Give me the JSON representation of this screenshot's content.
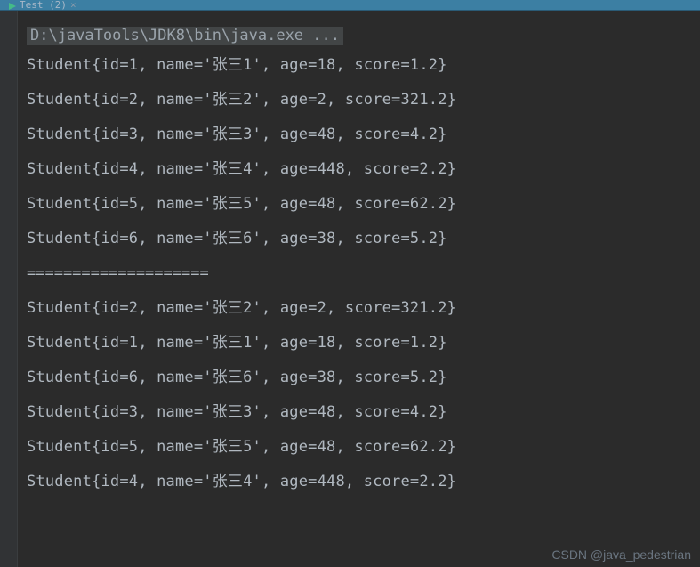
{
  "tab": {
    "label": "Test (2)",
    "close_glyph": "×"
  },
  "console": {
    "command": "D:\\javaTools\\JDK8\\bin\\java.exe ...",
    "lines_before": [
      "Student{id=1, name='张三1', age=18, score=1.2}",
      "Student{id=2, name='张三2', age=2, score=321.2}",
      "Student{id=3, name='张三3', age=48, score=4.2}",
      "Student{id=4, name='张三4', age=448, score=2.2}",
      "Student{id=5, name='张三5', age=48, score=62.2}",
      "Student{id=6, name='张三6', age=38, score=5.2}"
    ],
    "separator": "====================",
    "lines_after": [
      "Student{id=2, name='张三2', age=2, score=321.2}",
      "Student{id=1, name='张三1', age=18, score=1.2}",
      "Student{id=6, name='张三6', age=38, score=5.2}",
      "Student{id=3, name='张三3', age=48, score=4.2}",
      "Student{id=5, name='张三5', age=48, score=62.2}",
      "Student{id=4, name='张三4', age=448, score=2.2}"
    ]
  },
  "watermark": "CSDN @java_pedestrian"
}
